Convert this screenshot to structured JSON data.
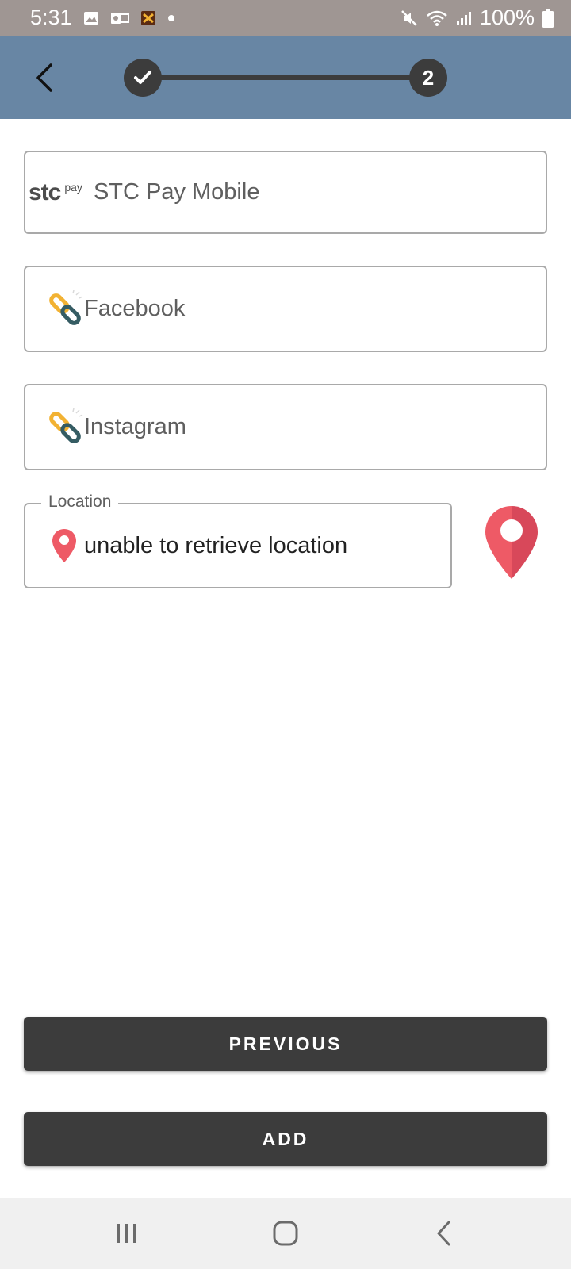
{
  "status_bar": {
    "time": "5:31",
    "battery": "100%",
    "icons": [
      "gallery-icon",
      "outlook-icon",
      "app-icon",
      "dot-icon",
      "mute-icon",
      "wifi-icon",
      "signal-icon",
      "battery-icon"
    ]
  },
  "app_bar": {
    "back_icon": "back-arrow-icon",
    "stepper": {
      "step1_icon": "check-icon",
      "step2_label": "2"
    }
  },
  "fields": {
    "stc": {
      "logo_main": "stc",
      "logo_sub": "pay",
      "value": "STC Pay Mobile"
    },
    "facebook": {
      "icon": "link-icon",
      "value": "Facebook"
    },
    "instagram": {
      "icon": "link-icon",
      "value": "Instagram"
    },
    "location": {
      "label": "Location",
      "icon": "location-pin-icon",
      "value": "unable to retrieve location"
    }
  },
  "buttons": {
    "previous": "PREVIOUS",
    "add": "ADD"
  },
  "nav_bar": {
    "icons": [
      "recent-apps-icon",
      "home-icon",
      "back-icon"
    ]
  },
  "colors": {
    "status_bar": "#9f9693",
    "app_bar": "#6886a4",
    "stepper": "#3c3c3c",
    "button": "#3c3c3c",
    "pin": "#ee5a66"
  }
}
